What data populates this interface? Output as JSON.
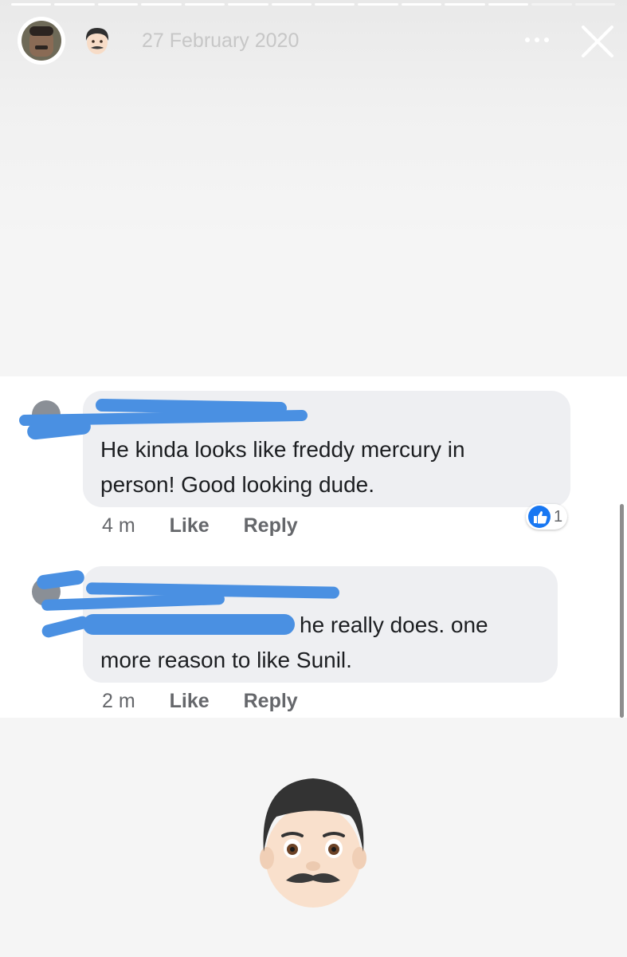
{
  "story": {
    "date": "27 February 2020",
    "more_label": "•••",
    "progress_segments": 14,
    "progress_viewed": 12
  },
  "colors": {
    "bubble": "#eeeff2",
    "redaction": "#4a90e2",
    "facebook_blue": "#1877f2",
    "meta_text": "#65676b"
  },
  "comments": [
    {
      "author_redacted": true,
      "text_lines": [
        "He kinda looks like freddy mercury in",
        "person! Good looking dude."
      ],
      "time": "4 m",
      "like_label": "Like",
      "reply_label": "Reply",
      "reaction_icon": "thumbs-up-icon",
      "reaction_count": "1"
    },
    {
      "author_redacted": true,
      "mention_redacted": true,
      "text_lines": [
        "he really does.  one",
        "more reason to like Sunil."
      ],
      "time": "2 m",
      "like_label": "Like",
      "reply_label": "Reply"
    }
  ],
  "sticker": "man-with-mustache-emoji"
}
